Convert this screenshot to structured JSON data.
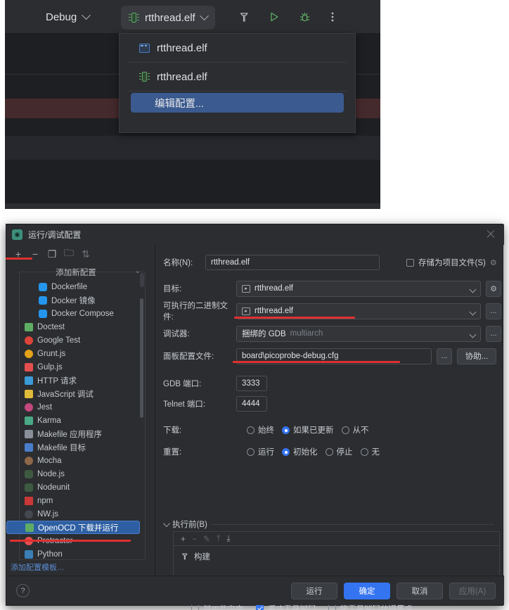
{
  "ide_toolbar": {
    "debug_label": "Debug",
    "config_label": "rtthread.elf",
    "icons": [
      "chip-icon",
      "chevron-down-icon",
      "hammer-build-icon",
      "run-play-icon",
      "debug-bug-icon",
      "more-vertical-icon"
    ]
  },
  "dropdown": {
    "items": [
      {
        "label": "rtthread.elf",
        "icon": "window-app-icon"
      },
      {
        "label": "rtthread.elf",
        "icon": "chip-icon"
      }
    ],
    "edit_label": "编辑配置..."
  },
  "dialog": {
    "title": "运行/调试配置",
    "close_icon": "close-icon",
    "left": {
      "toolbar": [
        "add-icon",
        "remove-icon",
        "copy-icon",
        "folder-add-icon",
        "sort-icon"
      ],
      "toolbar_glyphs": {
        "add": "+",
        "remove": "−",
        "copy": "❐",
        "folder": "🗀",
        "sort": "⇅"
      },
      "templates_header": "添加新配置",
      "collapse_icon": "collapse-icon",
      "items": [
        {
          "label": "Dockerfile",
          "indent": true,
          "color": "#2496ed"
        },
        {
          "label": "Docker 镜像",
          "indent": true,
          "color": "#2496ed"
        },
        {
          "label": "Docker Compose",
          "indent": true,
          "color": "#2496ed"
        },
        {
          "label": "Doctest",
          "indent": false,
          "color": "#5fad65"
        },
        {
          "label": "Google Test",
          "indent": false,
          "color": "#db4437"
        },
        {
          "label": "Grunt.js",
          "indent": false,
          "color": "#e3a21a"
        },
        {
          "label": "Gulp.js",
          "indent": false,
          "color": "#e34f4f"
        },
        {
          "label": "HTTP 请求",
          "indent": false,
          "color": "#3a9bd6"
        },
        {
          "label": "JavaScript 调试",
          "indent": false,
          "color": "#e0bc3a"
        },
        {
          "label": "Jest",
          "indent": false,
          "color": "#c2487e"
        },
        {
          "label": "Karma",
          "indent": false,
          "color": "#4aa886"
        },
        {
          "label": "Makefile 应用程序",
          "indent": false,
          "color": "#8a9099"
        },
        {
          "label": "Makefile 目标",
          "indent": false,
          "color": "#4a7ecb"
        },
        {
          "label": "Mocha",
          "indent": false,
          "color": "#8d6748"
        },
        {
          "label": "Node.js",
          "indent": false,
          "color": "#5fad65"
        },
        {
          "label": "Nodeunit",
          "indent": false,
          "color": "#5fad65"
        },
        {
          "label": "npm",
          "indent": false,
          "color": "#cb3837"
        },
        {
          "label": "NW.js",
          "indent": false,
          "color": "#8a9099"
        },
        {
          "label": "OpenOCD 下载并运行",
          "indent": false,
          "color": "#5fad65",
          "selected": true
        },
        {
          "label": "Protractor",
          "indent": false,
          "color": "#e34f4f"
        },
        {
          "label": "Python",
          "indent": false,
          "color": "#3a7fb8"
        }
      ],
      "add_template_link": "添加配置模板…"
    },
    "form": {
      "name_label": "名称(N):",
      "name_value": "rtthread.elf",
      "store_as_project_label": "存储为项目文件(S)",
      "store_as_project_checked": false,
      "store_gear_icon": "gear-icon",
      "target_label": "目标:",
      "target_value": "rtthread.elf",
      "target_gear_icon": "gear-icon",
      "executable_label": "可执行的二进制文件:",
      "executable_value": "rtthread.elf",
      "executable_browse": "...",
      "debugger_label": "调试器:",
      "debugger_value_bold": "捆绑的 GDB",
      "debugger_value_muted": "multiarch",
      "debugger_browse": "...",
      "board_cfg_label": "面板配置文件:",
      "board_cfg_value": "board\\picoprobe-debug.cfg",
      "board_cfg_browse": "...",
      "board_cfg_assist": "协助...",
      "gdb_port_label": "GDB 端口:",
      "gdb_port_value": "3333",
      "telnet_port_label": "Telnet 端口:",
      "telnet_port_value": "4444",
      "download_label": "下载:",
      "download_options": [
        "始终",
        "如果已更新",
        "从不"
      ],
      "download_selected": 1,
      "reset_label": "重置:",
      "reset_options": [
        "运行",
        "初始化",
        "停止",
        "无"
      ],
      "reset_selected": 1,
      "before_launch_label": "执行前(B)",
      "before_launch_tools": [
        "add-icon",
        "remove-icon",
        "edit-icon",
        "move-up-icon",
        "move-down-icon"
      ],
      "before_launch_tool_glyphs": {
        "add": "+",
        "remove": "−",
        "edit": "✎",
        "up": "⤒",
        "down": "⤓"
      },
      "before_launch_items": [
        {
          "label": "构建",
          "icon": "hammer-build-icon"
        }
      ],
      "bottom_checks": [
        {
          "label": "显示此页面",
          "checked": false
        },
        {
          "label": "激活工具窗口",
          "checked": true
        },
        {
          "label": "使工具窗口获得焦点",
          "checked": false
        }
      ]
    },
    "footer": {
      "help_label": "?",
      "run": "运行",
      "ok": "确定",
      "cancel": "取消",
      "apply": "应用(A)"
    }
  },
  "colors": {
    "accent_blue": "#3574f0",
    "selection_blue": "#2e5fa3",
    "annotation_red": "#e03030",
    "dialog_bg": "#2b2d30",
    "editor_bg": "#1e1f22"
  }
}
